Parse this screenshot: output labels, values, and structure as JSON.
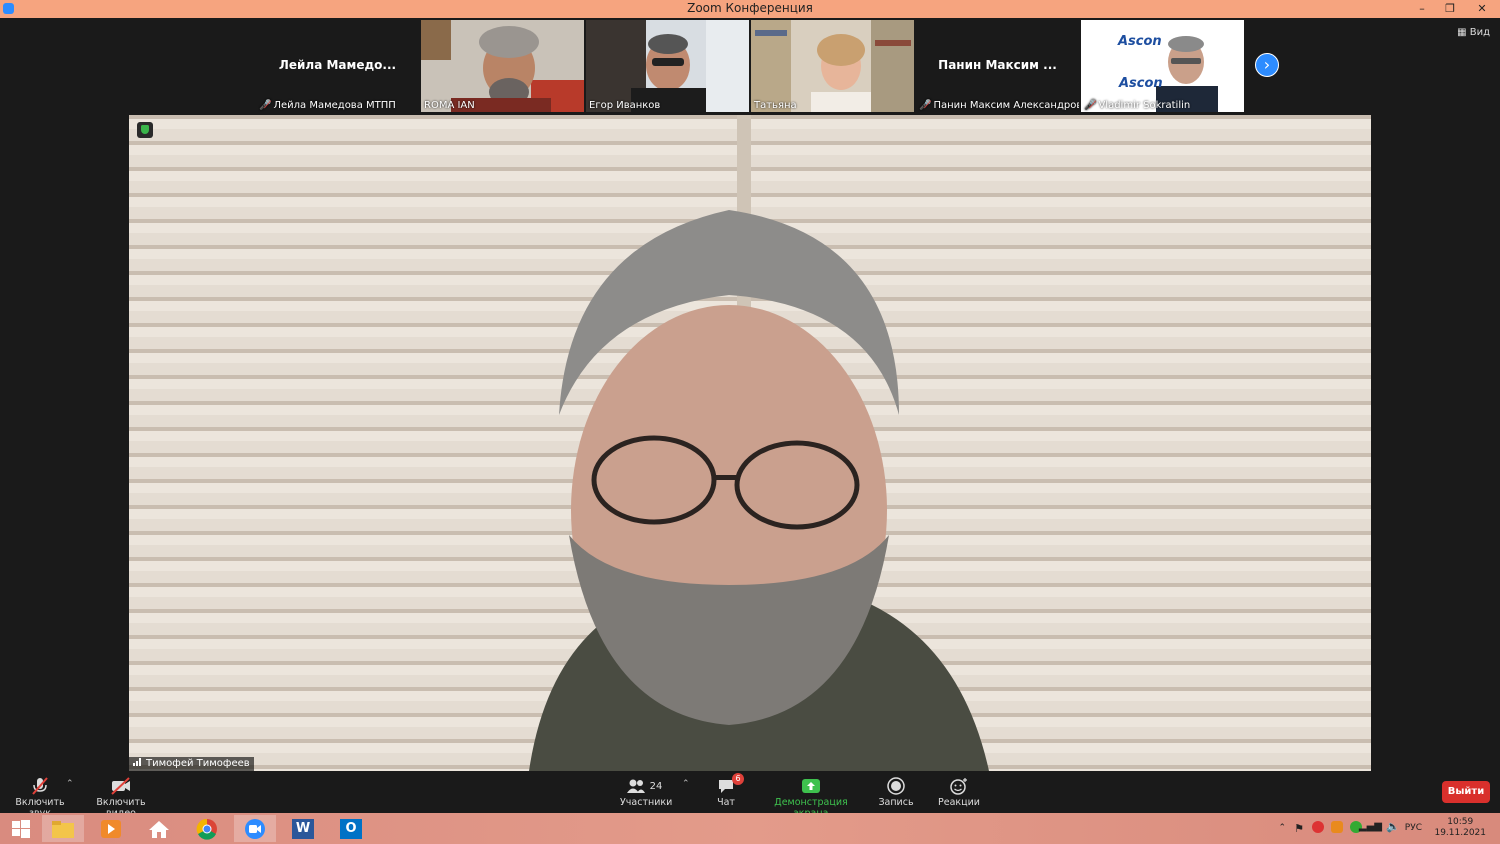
{
  "window": {
    "title": "Zoom Конференция",
    "minimize": "–",
    "maximize": "❐",
    "close": "✕"
  },
  "gallery": {
    "view_label": "Вид",
    "next_icon": "chevron-right-icon",
    "tiles": [
      {
        "big_name": "Лейла  Мамедо...",
        "label": "Лейла Мамедова МТПП",
        "muted": true,
        "has_video": false
      },
      {
        "big_name": "",
        "label": "ROMA IAN",
        "muted": false,
        "has_video": true
      },
      {
        "big_name": "",
        "label": "Егор Иванков",
        "muted": false,
        "has_video": true
      },
      {
        "big_name": "",
        "label": "Татьяна",
        "muted": false,
        "has_video": true
      },
      {
        "big_name": "Панин  Максим ...",
        "label": "Панин Максим Александров...",
        "muted": true,
        "has_video": false
      },
      {
        "big_name": "",
        "label": "Vladimir Sokratilin",
        "muted": true,
        "has_video": true,
        "logo_text": "Ascon",
        "logo_text2": "Ascon"
      }
    ]
  },
  "main": {
    "speaker_name": "Тимофей Тимофеев"
  },
  "toolbar": {
    "unmute": "Включить звук",
    "start_video": "Включить видео",
    "participants": "Участники",
    "participants_count": "24",
    "chat": "Чат",
    "chat_badge": "6",
    "share": "Демонстрация экрана",
    "record": "Запись",
    "reactions": "Реакции",
    "leave": "Выйти"
  },
  "taskbar": {
    "lang": "РУС",
    "time": "10:59",
    "date": "19.11.2021",
    "word_icon_letter": "W",
    "outlook_icon_letter": "O"
  }
}
